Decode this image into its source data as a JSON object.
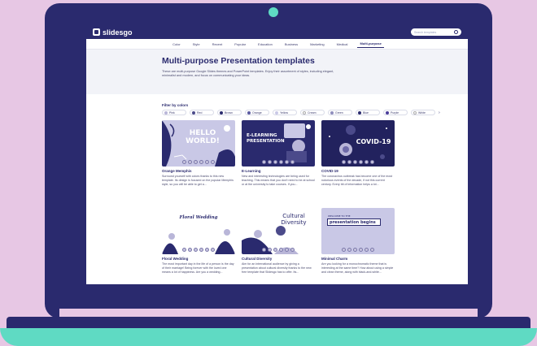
{
  "site": {
    "logo": "slidesgo",
    "search_placeholder": "Search templates"
  },
  "nav": [
    "Color",
    "Style",
    "Recent",
    "Popular",
    "Education",
    "Business",
    "Marketing",
    "Medical",
    "Multi-purpose"
  ],
  "hero": {
    "title": "Multi-purpose Presentation templates",
    "description": "These are multi-purpose Google Slides themes and PowerPoint templates. Enjoy their assortment of styles, including elegant, minimalist and modern, and focus on communicating your ideas."
  },
  "filters": {
    "heading": "Filter by colors",
    "colors": [
      {
        "label": "Pink",
        "color": "#b9b6d8"
      },
      {
        "label": "Red",
        "color": "#4b4a8a"
      },
      {
        "label": "Brown",
        "color": "#2a2a6e"
      },
      {
        "label": "Orange",
        "color": "#5a5aa0"
      },
      {
        "label": "Yellow",
        "color": "#c9c8e6"
      },
      {
        "label": "Cream",
        "color": "#ffffff"
      },
      {
        "label": "Green",
        "color": "#8f8dbd"
      },
      {
        "label": "Blue",
        "color": "#2a2a6e"
      },
      {
        "label": "Purple",
        "color": "#4a3d9a"
      },
      {
        "label": "White",
        "color": "#ffffff"
      }
    ]
  },
  "cards": [
    {
      "title": "Orange Memphis",
      "desc": "Surround yourself with colors thanks to this new template. Its design is focused on the popular Memphis style, so you will be able to get a...",
      "thumb_text": "HELLO WORLD!"
    },
    {
      "title": "E-Learning",
      "desc": "New and interesting technologies are being used for teaching. This means that you don't need to be at school or at the university to take courses. If you...",
      "thumb_text": "E-LEARNING PRESENTATION"
    },
    {
      "title": "COVID-19",
      "desc": "The coronavirus outbreak has become one of the most notorious events of the decade, if not this current century. Every bit of information helps a lot...",
      "thumb_text": "COVID-19"
    },
    {
      "title": "Floral Wedding",
      "desc": "The most important day in the life of a person is the day of their marriage! Being forever with the loved one means a lot of happiness. Are you a wedding...",
      "thumb_text": "Floral Wedding"
    },
    {
      "title": "Cultural Diversity",
      "desc": "Aim for an international audience by giving a presentation about cultural diversity thanks to the new free template that Slidesgo has to offer. Its...",
      "thumb_text": "Cultural Diversity"
    },
    {
      "title": "Minimal Charm",
      "desc": "Are you looking for a monochromatic theme that is interesting at the same time? How about using a simple and clean theme, along with black-and-white...",
      "thumb_text": "presentation begins",
      "thumb_subtext": "WELCOME TO THE"
    }
  ],
  "colors": {
    "navy": "#2a2a6e",
    "mint": "#5fdac3",
    "pink_bg": "#e7c7e4",
    "lavender": "#b9b6d8"
  }
}
